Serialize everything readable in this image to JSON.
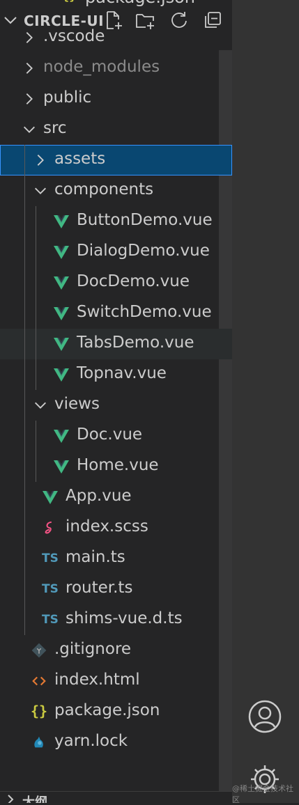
{
  "peek": {
    "label": "package.json"
  },
  "explorer": {
    "title": "CIRCLE-UI"
  },
  "tree": [
    {
      "label": ".vscode",
      "type": "folder",
      "depth": 0,
      "expanded": false
    },
    {
      "label": "node_modules",
      "type": "folder",
      "depth": 0,
      "expanded": false,
      "dim": true
    },
    {
      "label": "public",
      "type": "folder",
      "depth": 0,
      "expanded": false
    },
    {
      "label": "src",
      "type": "folder",
      "depth": 0,
      "expanded": true
    },
    {
      "label": "assets",
      "type": "folder",
      "depth": 1,
      "expanded": false,
      "selected": true
    },
    {
      "label": "components",
      "type": "folder",
      "depth": 1,
      "expanded": true
    },
    {
      "label": "ButtonDemo.vue",
      "type": "vue",
      "depth": 2
    },
    {
      "label": "DialogDemo.vue",
      "type": "vue",
      "depth": 2
    },
    {
      "label": "DocDemo.vue",
      "type": "vue",
      "depth": 2
    },
    {
      "label": "SwitchDemo.vue",
      "type": "vue",
      "depth": 2
    },
    {
      "label": "TabsDemo.vue",
      "type": "vue",
      "depth": 2,
      "hover": true
    },
    {
      "label": "Topnav.vue",
      "type": "vue",
      "depth": 2
    },
    {
      "label": "views",
      "type": "folder",
      "depth": 1,
      "expanded": true
    },
    {
      "label": "Doc.vue",
      "type": "vue",
      "depth": 2
    },
    {
      "label": "Home.vue",
      "type": "vue",
      "depth": 2
    },
    {
      "label": "App.vue",
      "type": "vue",
      "depth": 1
    },
    {
      "label": "index.scss",
      "type": "scss",
      "depth": 1
    },
    {
      "label": "main.ts",
      "type": "ts",
      "depth": 1
    },
    {
      "label": "router.ts",
      "type": "ts",
      "depth": 1
    },
    {
      "label": "shims-vue.d.ts",
      "type": "ts",
      "depth": 1
    },
    {
      "label": ".gitignore",
      "type": "git",
      "depth": 0
    },
    {
      "label": "index.html",
      "type": "html",
      "depth": 0
    },
    {
      "label": "package.json",
      "type": "json",
      "depth": 0
    },
    {
      "label": "yarn.lock",
      "type": "yarn",
      "depth": 0
    }
  ],
  "icons": {
    "ts_text": "TS",
    "json_text": "{}"
  },
  "bottom": {
    "label": "大纲"
  },
  "watermark": "@稀土掘金技术社区",
  "colors": {
    "vue": "#41b883",
    "ts": "#519aba",
    "html": "#e37933",
    "json": "#cbcb41",
    "scss": "#f55385",
    "git": "#41535b",
    "yarn": "#2188b6",
    "selected_bg": "#094771",
    "selected_border": "#3794ff"
  }
}
